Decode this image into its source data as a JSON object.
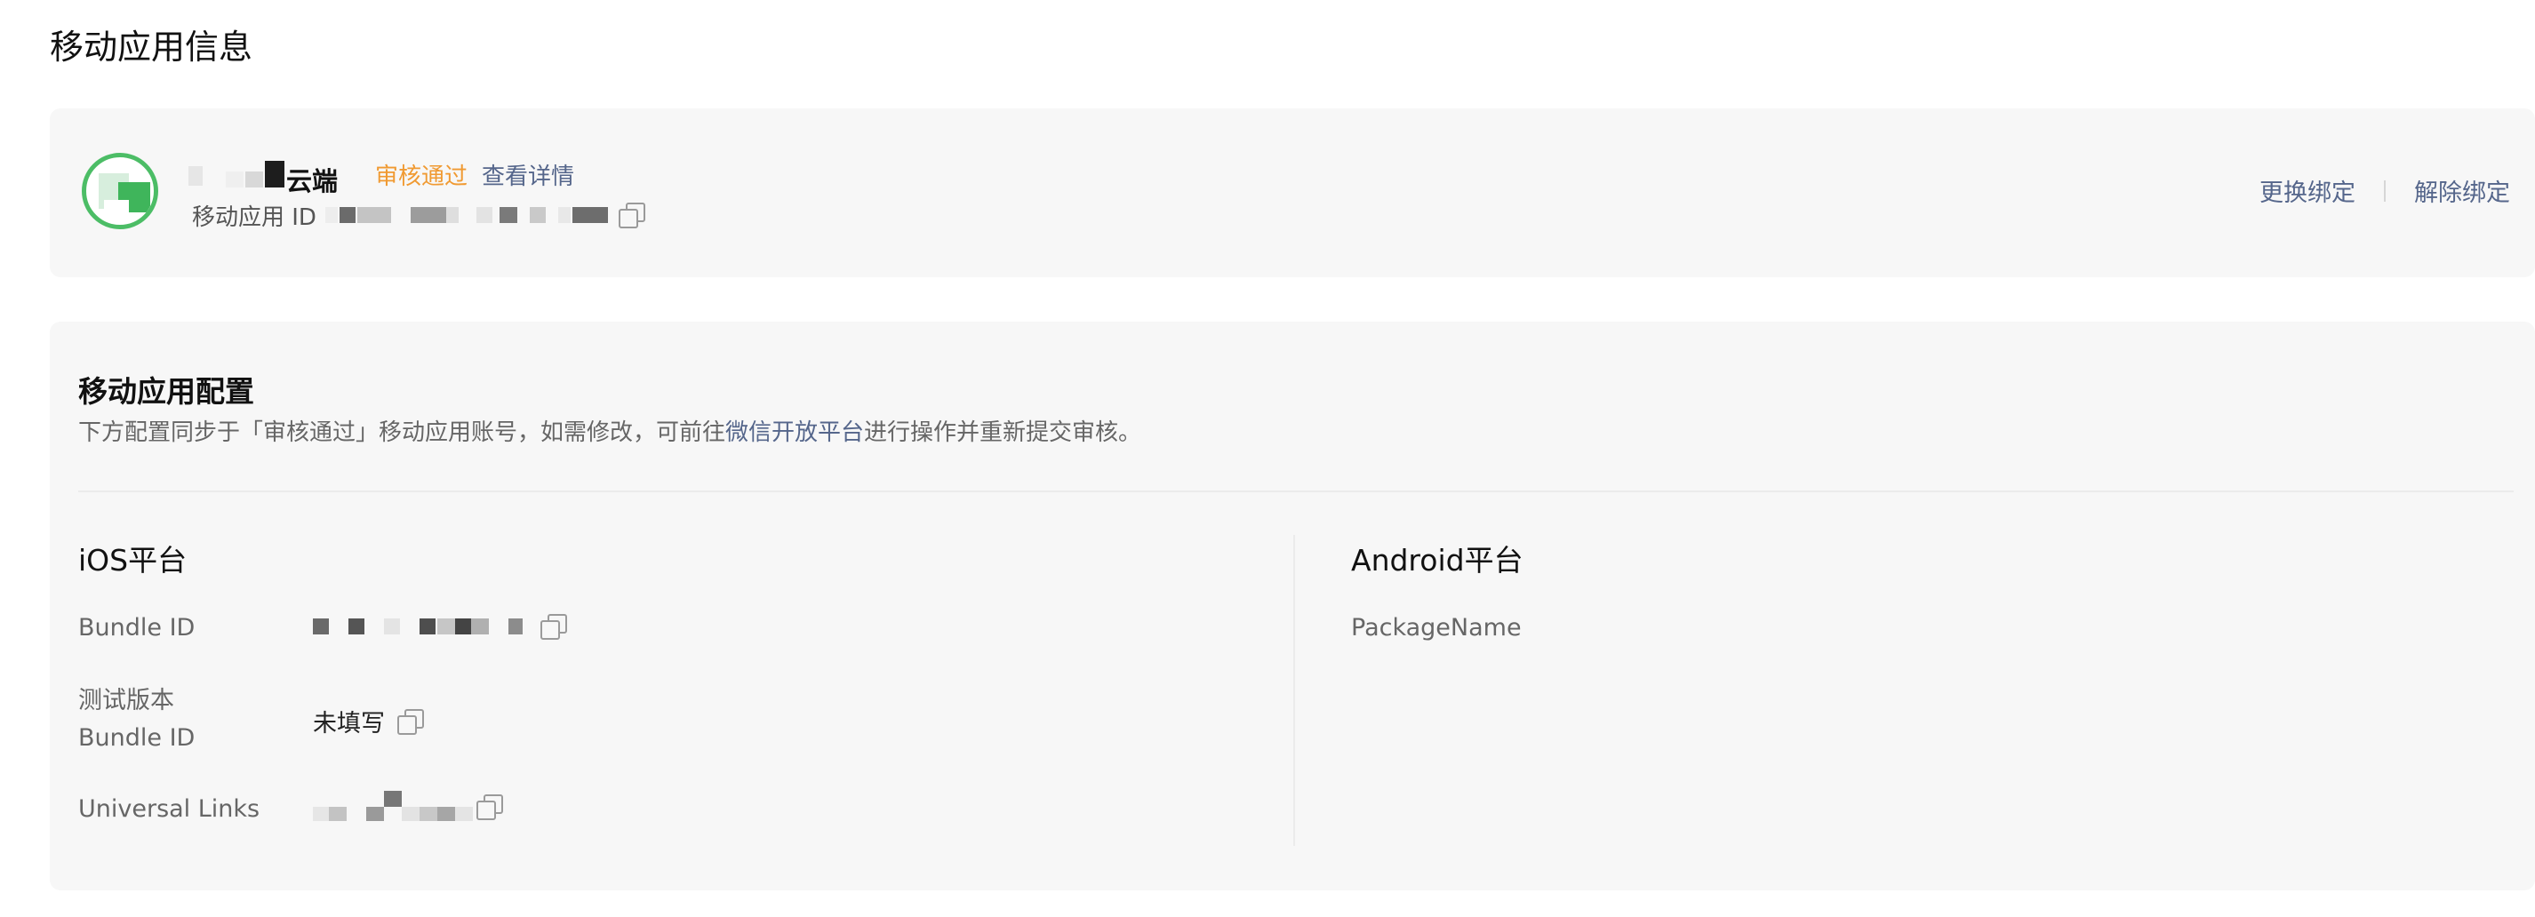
{
  "page": {
    "title": "移动应用信息"
  },
  "app": {
    "name_visible_fragment": "云端",
    "status": "审核通过",
    "view_details": "查看详情",
    "id_label": "移动应用 ID",
    "actions": {
      "rebind": "更换绑定",
      "unbind": "解除绑定"
    }
  },
  "config": {
    "title": "移动应用配置",
    "desc_prefix": "下方配置同步于「审核通过」移动应用账号，如需修改，可前往",
    "desc_link": "微信开放平台",
    "desc_suffix": "进行操作并重新提交审核。",
    "ios": {
      "title": "iOS平台",
      "bundle_id_label": "Bundle ID",
      "test_bundle_label_line1": "测试版本",
      "test_bundle_label_line2": "Bundle ID",
      "test_bundle_value": "未填写",
      "universal_links_label": "Universal Links"
    },
    "android": {
      "title": "Android平台",
      "package_name_label": "PackageName"
    }
  },
  "colors": {
    "status_approved": "#f09a32",
    "link": "#55668b",
    "card_bg": "#f7f7f7",
    "logo_green": "#4cbd66"
  },
  "icons": [
    "app-logo",
    "copy-icon"
  ]
}
